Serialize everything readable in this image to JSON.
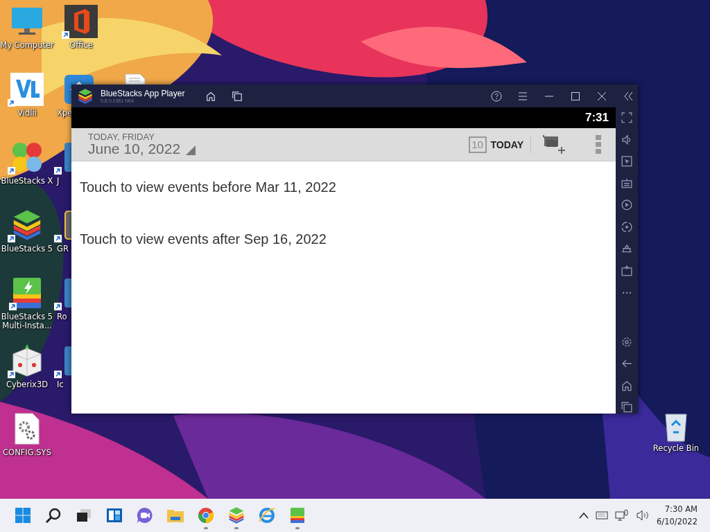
{
  "desktop": {
    "icons": [
      {
        "label": "My Computer",
        "kind": "computer",
        "shortcut": false
      },
      {
        "label": "Vidlii",
        "kind": "vidlii",
        "shortcut": true
      },
      {
        "label": "BlueStacks X",
        "kind": "bsx",
        "shortcut": true
      },
      {
        "label": "BlueStacks 5",
        "kind": "bluestacks",
        "shortcut": true
      },
      {
        "label": "BlueStacks 5 Multi-Insta...",
        "kind": "multi",
        "shortcut": true
      },
      {
        "label": "Cyberix3D",
        "kind": "cube",
        "shortcut": true
      },
      {
        "label": "CONFIG.SYS",
        "kind": "config",
        "shortcut": false
      },
      {
        "label": "Office",
        "kind": "office",
        "shortcut": true
      },
      {
        "label": "Xpe",
        "kind": "house",
        "shortcut": false
      },
      {
        "label": "J",
        "kind": "generic",
        "shortcut": true
      },
      {
        "label": "GR",
        "kind": "dark",
        "shortcut": true
      },
      {
        "label": "Ro",
        "kind": "generic",
        "shortcut": true
      },
      {
        "label": "Ic",
        "kind": "generic",
        "shortcut": true
      }
    ],
    "recycle_bin": {
      "label": "Recycle Bin"
    }
  },
  "window": {
    "title": "BlueStacks App Player",
    "version": "5.8.0.1081 N64"
  },
  "android": {
    "clock": "7:31",
    "header": {
      "caption": "TODAY, FRIDAY",
      "date": "June 10, 2022",
      "today_day": "10",
      "today_label": "TODAY"
    },
    "events": [
      "Touch to view events before Mar 11, 2022",
      "Touch to view events after Sep 16, 2022"
    ]
  },
  "taskbar": {
    "apps": [
      {
        "kind": "start",
        "running": false
      },
      {
        "kind": "search",
        "running": false
      },
      {
        "kind": "taskview",
        "running": false
      },
      {
        "kind": "widgets",
        "running": false
      },
      {
        "kind": "chat",
        "running": false
      },
      {
        "kind": "explorer",
        "running": false
      },
      {
        "kind": "chrome",
        "running": true
      },
      {
        "kind": "bluestacks",
        "running": true
      },
      {
        "kind": "ie",
        "running": false
      },
      {
        "kind": "multi",
        "running": true
      }
    ],
    "time": "7:30 AM",
    "date": "6/10/2022"
  }
}
